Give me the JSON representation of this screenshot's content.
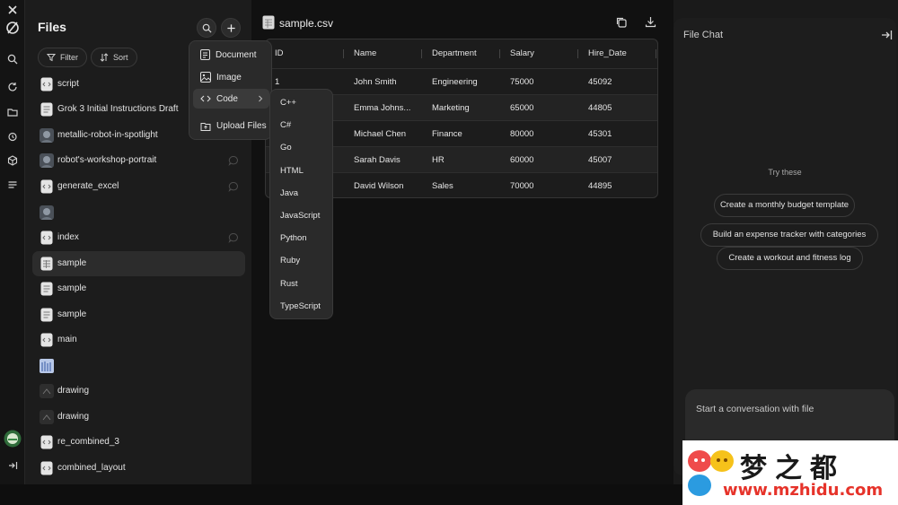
{
  "files_panel": {
    "title": "Files",
    "filter_label": "Filter",
    "sort_label": "Sort",
    "items": [
      {
        "label": "script",
        "icon": "code-file-icon"
      },
      {
        "label": "Grok 3 Initial Instructions Draft",
        "icon": "document-icon"
      },
      {
        "label": "metallic-robot-in-spotlight",
        "icon": "image-thumbnail-icon"
      },
      {
        "label": "robot's-workshop-portrait",
        "icon": "image-thumbnail-icon"
      },
      {
        "label": "generate_excel",
        "icon": "code-file-icon"
      },
      {
        "label": "",
        "icon": "image-thumbnail-icon"
      },
      {
        "label": "index",
        "icon": "code-file-icon"
      },
      {
        "label": "sample",
        "icon": "spreadsheet-icon"
      },
      {
        "label": "sample",
        "icon": "document-icon"
      },
      {
        "label": "sample",
        "icon": "document-icon"
      },
      {
        "label": "main",
        "icon": "code-file-icon"
      },
      {
        "label": "",
        "icon": "chart-thumbnail-icon"
      },
      {
        "label": "drawing",
        "icon": "drawing-icon"
      },
      {
        "label": "drawing",
        "icon": "drawing-icon"
      },
      {
        "label": "re_combined_3",
        "icon": "code-file-icon"
      },
      {
        "label": "combined_layout",
        "icon": "code-file-icon"
      }
    ],
    "selected_index": 7
  },
  "add_menu": {
    "items": [
      {
        "label": "Document",
        "icon": "document-icon"
      },
      {
        "label": "Image",
        "icon": "image-icon"
      },
      {
        "label": "Code",
        "icon": "code-icon"
      },
      {
        "label": "Upload Files",
        "icon": "upload-icon"
      }
    ]
  },
  "code_menu": {
    "items": [
      "C++",
      "C#",
      "Go",
      "HTML",
      "Java",
      "JavaScript",
      "Python",
      "Ruby",
      "Rust",
      "TypeScript"
    ]
  },
  "document": {
    "title": "sample.csv",
    "columns": [
      "ID",
      "Name",
      "Department",
      "Salary",
      "Hire_Date"
    ],
    "rows": [
      [
        "1",
        "John Smith",
        "Engineering",
        "75000",
        "45092"
      ],
      [
        "",
        "Emma Johns...",
        "Marketing",
        "65000",
        "44805"
      ],
      [
        "",
        "Michael Chen",
        "Finance",
        "80000",
        "45301"
      ],
      [
        "",
        "Sarah Davis",
        "HR",
        "60000",
        "45007"
      ],
      [
        "",
        "David Wilson",
        "Sales",
        "70000",
        "44895"
      ]
    ]
  },
  "chat": {
    "title": "File Chat",
    "try_these": "Try these",
    "suggestions": [
      "Create a monthly budget template",
      "Build an expense tracker with categories",
      "Create a workout and fitness log"
    ],
    "input_placeholder": "Start a conversation with file"
  },
  "watermark": {
    "chinese": "梦之都",
    "url": "www.mzhidu.com"
  }
}
